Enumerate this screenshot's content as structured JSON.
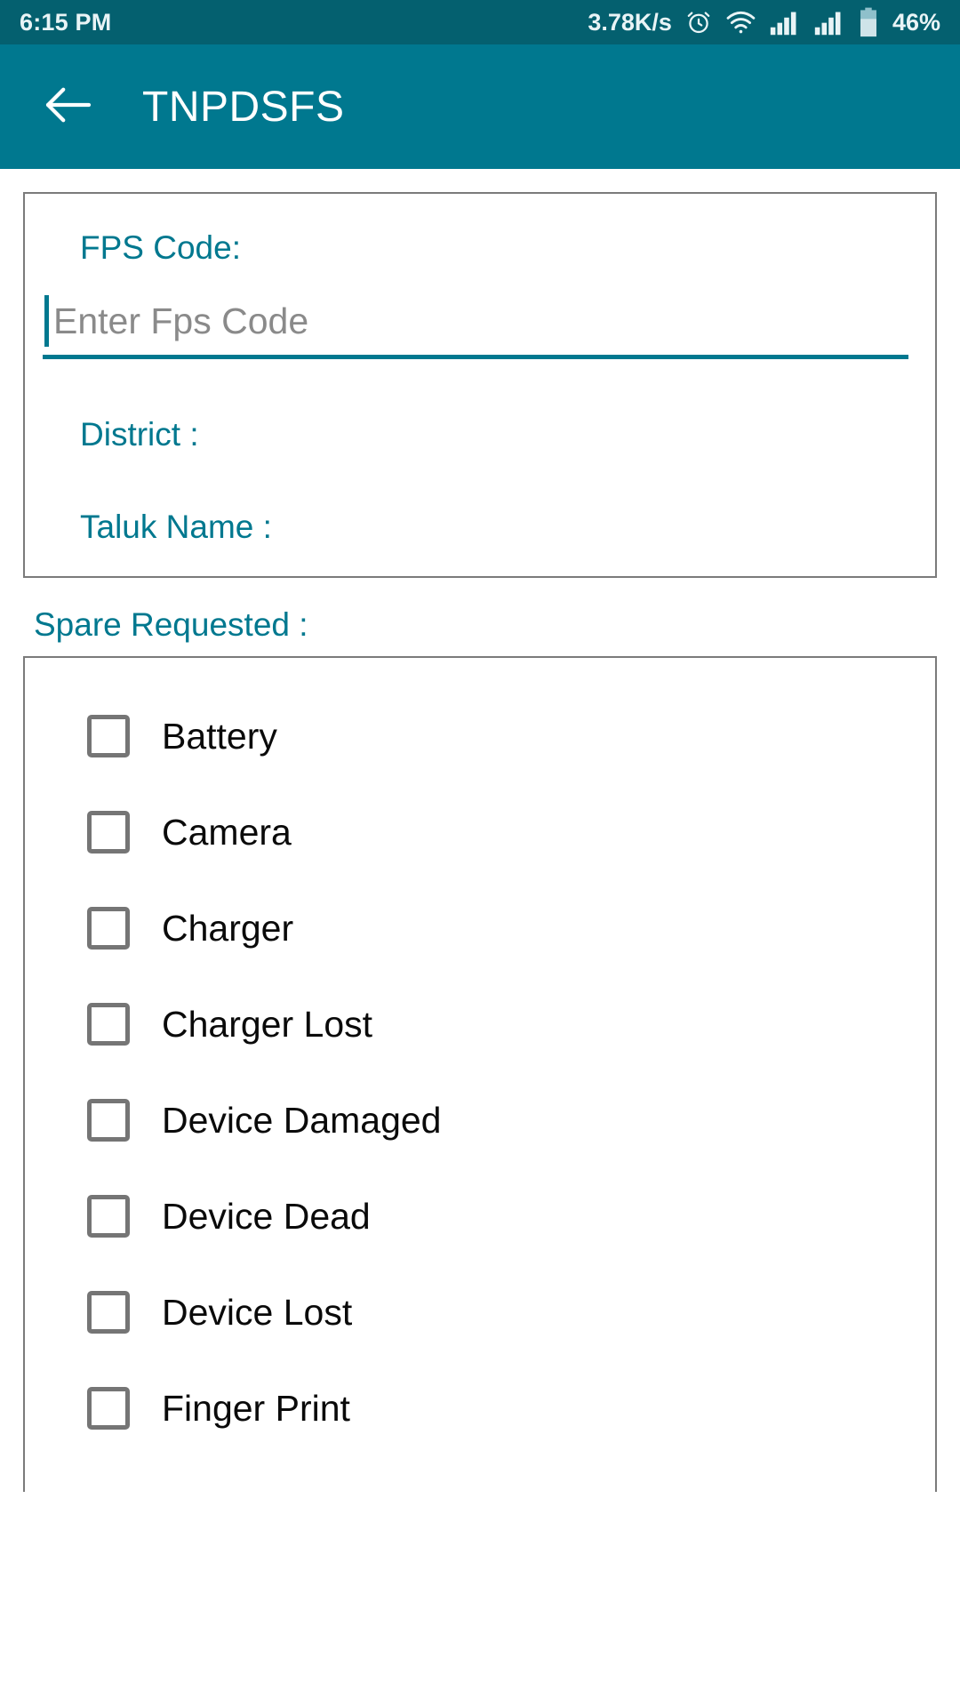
{
  "status_bar": {
    "time": "6:15 PM",
    "network_speed": "3.78K/s",
    "battery_percent": "46%",
    "icons": [
      "alarm-clock-icon",
      "wifi-icon",
      "signal-bars-icon",
      "signal-bars-icon",
      "battery-icon"
    ],
    "background_color": "#04606f",
    "text_color": "#e9f4f6"
  },
  "app_bar": {
    "back_icon": "back-arrow-icon",
    "title": "TNPDSFS",
    "background_color": "#00788f",
    "title_color": "#ffffff"
  },
  "form": {
    "fps_code_label": "FPS Code:",
    "fps_code_value": "",
    "fps_code_placeholder": "Enter Fps Code",
    "district_label": "District :",
    "taluk_label": "Taluk Name :",
    "accent_color": "#00788f",
    "placeholder_color": "#8a8a8a",
    "card_border_color": "#7b7b7b"
  },
  "spare": {
    "section_label": "Spare Requested :",
    "items": [
      {
        "label": "Battery",
        "checked": false
      },
      {
        "label": "Camera",
        "checked": false
      },
      {
        "label": "Charger",
        "checked": false
      },
      {
        "label": "Charger Lost",
        "checked": false
      },
      {
        "label": "Device Damaged",
        "checked": false
      },
      {
        "label": "Device Dead",
        "checked": false
      },
      {
        "label": "Device Lost",
        "checked": false
      },
      {
        "label": "Finger Print",
        "checked": false
      }
    ],
    "checkbox_border_color": "#757575",
    "label_color": "#0a0a0a"
  }
}
